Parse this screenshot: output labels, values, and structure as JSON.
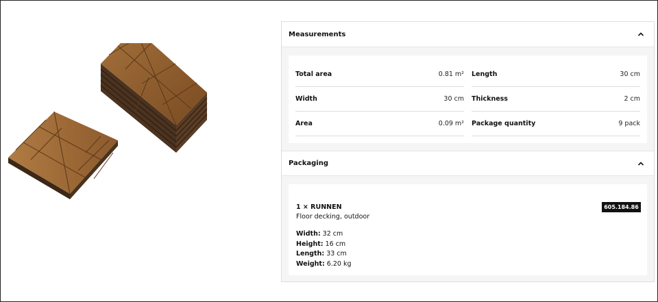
{
  "measurements": {
    "title": "Measurements",
    "left": [
      {
        "label": "Total area",
        "value": "0.81 m²"
      },
      {
        "label": "Width",
        "value": "30 cm"
      },
      {
        "label": "Area",
        "value": "0.09 m²"
      }
    ],
    "right": [
      {
        "label": "Length",
        "value": "30 cm"
      },
      {
        "label": "Thickness",
        "value": "2 cm"
      },
      {
        "label": "Package quantity",
        "value": "9 pack"
      }
    ]
  },
  "packaging": {
    "title": "Packaging",
    "name": "1 × RUNNEN",
    "description": "Floor decking, outdoor",
    "article_number": "605.184.86",
    "dimensions": [
      {
        "label": "Width:",
        "value": "32 cm"
      },
      {
        "label": "Height:",
        "value": "16 cm"
      },
      {
        "label": "Length:",
        "value": "33 cm"
      },
      {
        "label": "Weight:",
        "value": "6.20 kg"
      }
    ]
  },
  "image": {
    "icon": "wooden-floor-decking-tiles-image"
  },
  "colors": {
    "badge": "#111111",
    "panel_bg": "#f5f5f5",
    "wood": "#8a5a2b"
  }
}
